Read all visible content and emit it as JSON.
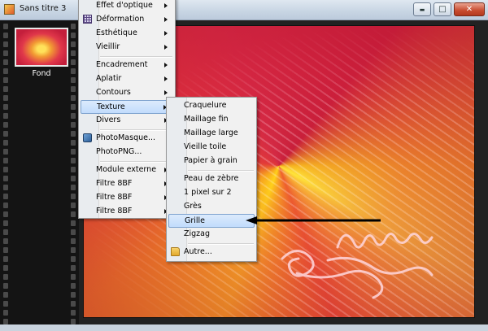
{
  "window": {
    "title": "Sans titre 3",
    "minimize_glyph": "▬",
    "maximize_glyph": "□",
    "close_glyph": "✕"
  },
  "layers": [
    {
      "label": "Fond"
    }
  ],
  "main_menu": {
    "items": [
      {
        "label": "Effet d'optique",
        "submenu": true
      },
      {
        "label": "Déformation",
        "submenu": true,
        "icon": "grid-icon"
      },
      {
        "label": "Esthétique",
        "submenu": true
      },
      {
        "label": "Vieillir",
        "submenu": true
      },
      {
        "label": "Encadrement",
        "submenu": true
      },
      {
        "label": "Aplatir",
        "submenu": true
      },
      {
        "label": "Contours",
        "submenu": true
      },
      {
        "label": "Texture",
        "submenu": true,
        "highlighted": true
      },
      {
        "label": "Divers",
        "submenu": true
      },
      {
        "label": "PhotoMasque...",
        "icon": "photomask-icon"
      },
      {
        "label": "PhotoPNG..."
      },
      {
        "label": "Module externe",
        "submenu": true
      },
      {
        "label": "Filtre 8BF",
        "submenu": true
      },
      {
        "label": "Filtre 8BF",
        "submenu": true
      },
      {
        "label": "Filtre 8BF",
        "submenu": true
      }
    ]
  },
  "texture_submenu": {
    "items": [
      {
        "label": "Craquelure"
      },
      {
        "label": "Maillage fin"
      },
      {
        "label": "Maillage large"
      },
      {
        "label": "Vieille toile"
      },
      {
        "label": "Papier à grain"
      },
      {
        "label": "Peau de zèbre"
      },
      {
        "label": "1 pixel sur 2"
      },
      {
        "label": "Grès"
      },
      {
        "label": "Grille",
        "highlighted": true
      },
      {
        "label": "Zigzag"
      },
      {
        "label": "Autre...",
        "icon": "folder-open-icon"
      }
    ]
  },
  "colors": {
    "menu_highlight": "#c1dcfc",
    "canvas_red": "#d1283f",
    "canvas_yellow": "#ffd21a"
  }
}
